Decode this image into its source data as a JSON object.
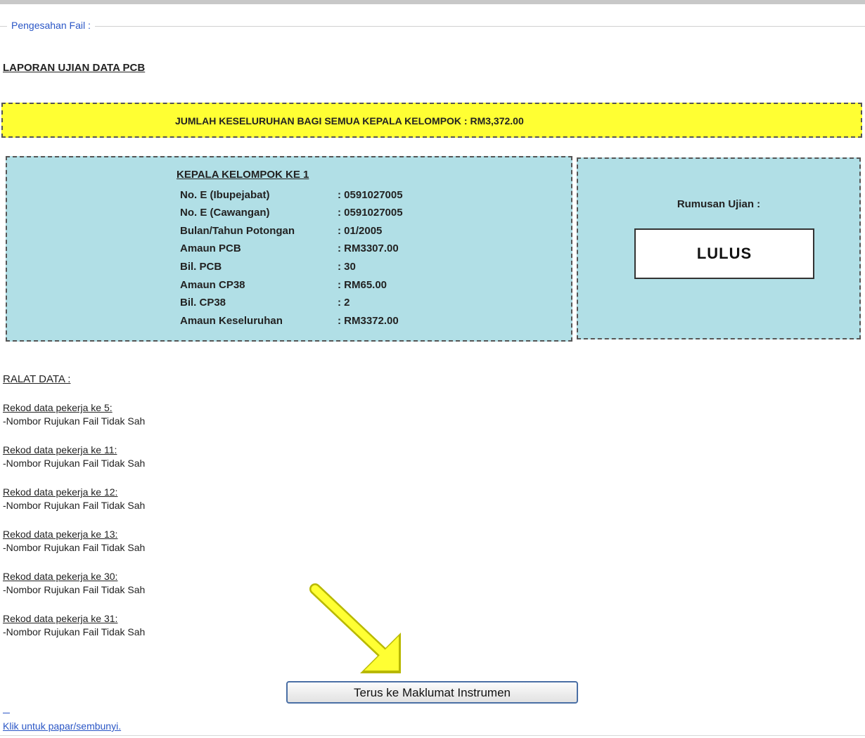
{
  "fieldset": {
    "legend": "Pengesahan Fail :"
  },
  "report": {
    "title": "LAPORAN  UJIAN DATA PCB"
  },
  "total": {
    "text": "JUMLAH KESELURUHAN BAGI SEMUA KEPALA KELOMPOK : RM3,372.00"
  },
  "group": {
    "title": "KEPALA  KELOMPOK KE 1",
    "rows": [
      {
        "label": "No. E (Ibupejabat)",
        "value": ": 0591027005"
      },
      {
        "label": "No. E (Cawangan)",
        "value": ": 0591027005"
      },
      {
        "label": "Bulan/Tahun Potongan",
        "value": ": 01/2005"
      },
      {
        "label": "Amaun  PCB",
        "value": ": RM3307.00"
      },
      {
        "label": "Bil. PCB",
        "value": ": 30"
      },
      {
        "label": "Amaun  CP38",
        "value": ": RM65.00"
      },
      {
        "label": "Bil. CP38",
        "value": ": 2"
      },
      {
        "label": "Amaun  Keseluruhan",
        "value": ": RM3372.00"
      }
    ]
  },
  "summary": {
    "label": "Rumusan Ujian :",
    "result": "LULUS"
  },
  "errors": {
    "title": "RALAT DATA :",
    "items": [
      {
        "record": "Rekod data pekerja ke 5:",
        "message": "-Nombor Rujukan Fail Tidak Sah"
      },
      {
        "record": "Rekod data pekerja ke 11:",
        "message": "-Nombor Rujukan Fail Tidak Sah"
      },
      {
        "record": "Rekod data pekerja ke 12:",
        "message": "-Nombor Rujukan Fail Tidak Sah"
      },
      {
        "record": "Rekod data pekerja ke 13:",
        "message": "-Nombor Rujukan Fail Tidak Sah"
      },
      {
        "record": "Rekod data pekerja ke 30:",
        "message": "-Nombor Rujukan Fail Tidak Sah"
      },
      {
        "record": "Rekod data pekerja ke 31:",
        "message": "-Nombor Rujukan Fail Tidak Sah"
      }
    ]
  },
  "actions": {
    "continue_label": "Terus ke  Maklumat  Instrumen"
  },
  "toggle": {
    "label": "Klik untuk papar/sembunyi."
  },
  "colors": {
    "banner": "#ffff33",
    "panel": "#b1dfe6",
    "link": "#2a56c6",
    "arrow": "#ffff33"
  }
}
